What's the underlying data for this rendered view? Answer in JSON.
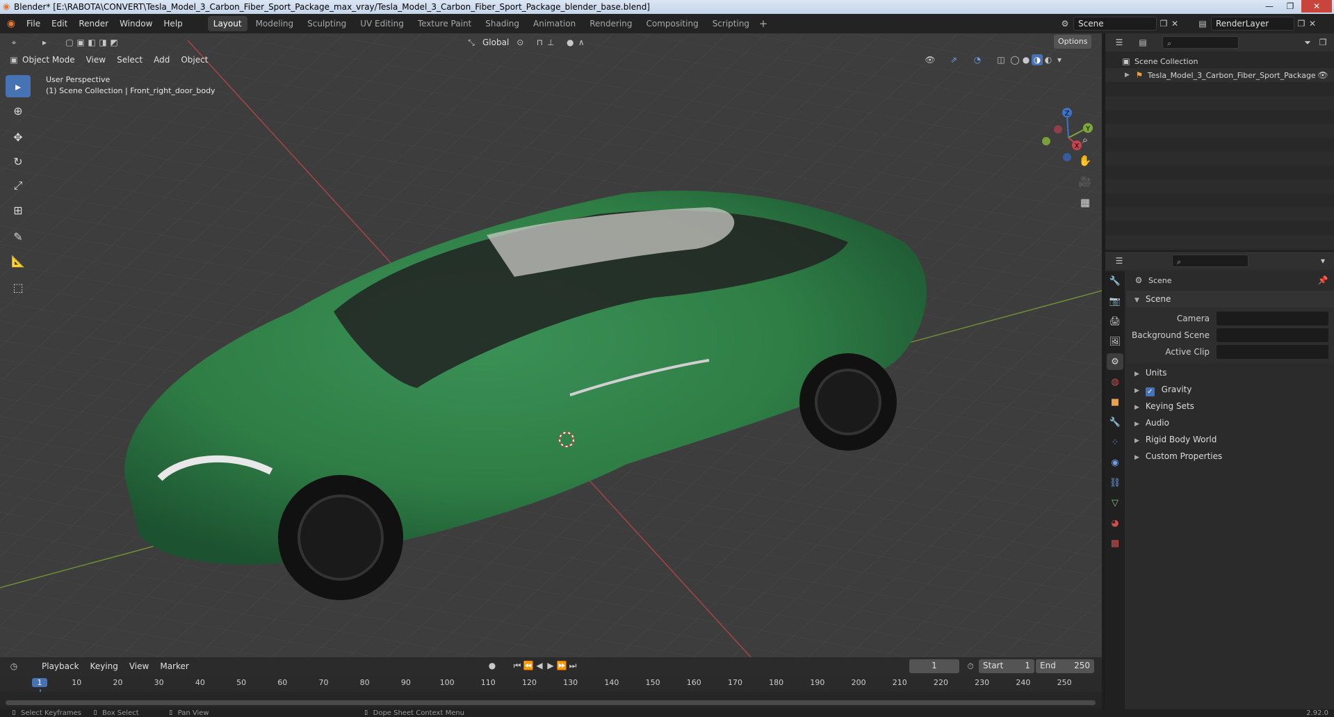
{
  "window": {
    "title": "Blender* [E:\\RABOTA\\CONVERT\\Tesla_Model_3_Carbon_Fiber_Sport_Package_max_vray/Tesla_Model_3_Carbon_Fiber_Sport_Package_blender_base.blend]"
  },
  "menu": {
    "items": [
      "File",
      "Edit",
      "Render",
      "Window",
      "Help"
    ]
  },
  "workspaces": [
    "Layout",
    "Modeling",
    "Sculpting",
    "UV Editing",
    "Texture Paint",
    "Shading",
    "Animation",
    "Rendering",
    "Compositing",
    "Scripting"
  ],
  "scene_selector": {
    "scene": "Scene",
    "view_layer": "RenderLayer"
  },
  "viewport": {
    "mode": "Object Mode",
    "menu": [
      "View",
      "Select",
      "Add",
      "Object"
    ],
    "orientation": "Global",
    "options_label": "Options",
    "overlay_title": "User Perspective",
    "overlay_subtitle": "(1) Scene Collection | Front_right_door_body",
    "gizmo_axes": [
      "X",
      "Y",
      "Z"
    ]
  },
  "outliner": {
    "root": "Scene Collection",
    "items": [
      "Tesla_Model_3_Carbon_Fiber_Sport_Package"
    ]
  },
  "properties": {
    "header": "Scene",
    "section": "Scene",
    "fields": [
      {
        "label": "Camera",
        "value": ""
      },
      {
        "label": "Background Scene",
        "value": ""
      },
      {
        "label": "Active Clip",
        "value": ""
      }
    ],
    "panels": [
      "Units",
      "Gravity",
      "Keying Sets",
      "Audio",
      "Rigid Body World",
      "Custom Properties"
    ],
    "gravity_checked": true
  },
  "timeline": {
    "menu": [
      "Playback",
      "Keying",
      "View",
      "Marker"
    ],
    "current_frame": "1",
    "start_label": "Start",
    "start": "1",
    "end_label": "End",
    "end": "250",
    "ruler": [
      "1",
      "10",
      "20",
      "30",
      "40",
      "50",
      "60",
      "70",
      "80",
      "90",
      "100",
      "110",
      "120",
      "130",
      "140",
      "150",
      "160",
      "170",
      "180",
      "190",
      "200",
      "210",
      "220",
      "230",
      "240",
      "250"
    ]
  },
  "statusbar": {
    "items": [
      "Select Keyframes",
      "Box Select",
      "Pan View",
      "Dope Sheet Context Menu"
    ],
    "version": "2.92.0"
  },
  "colors": {
    "accent": "#4772b3",
    "car_body": "#2e7d45",
    "x_axis": "#c8434f",
    "y_axis": "#7fa83a",
    "z_axis": "#3d73c6"
  }
}
